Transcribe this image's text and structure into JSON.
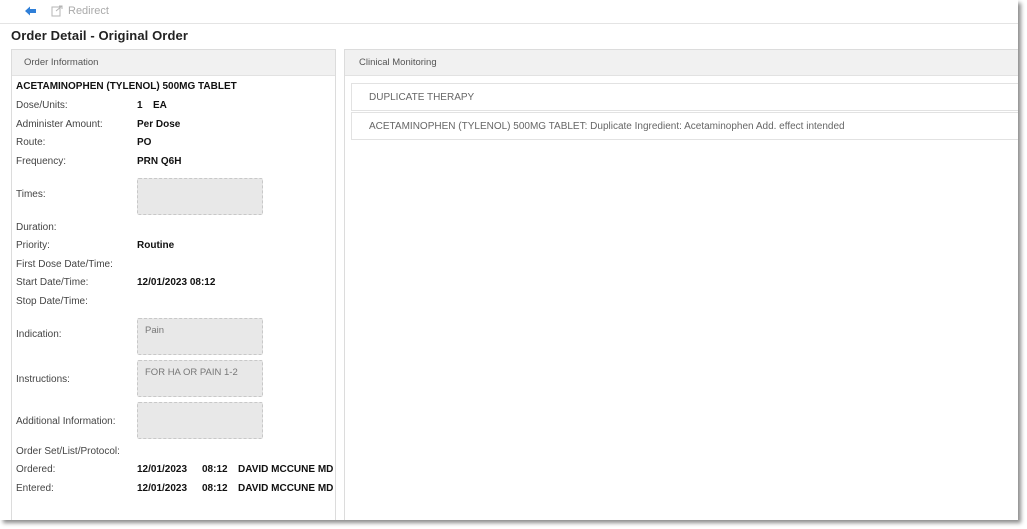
{
  "toolbar": {
    "back_icon": "back-arrow-icon",
    "redirect_label": "Redirect"
  },
  "page_title": "Order Detail - Original Order",
  "order_info": {
    "header": "Order Information",
    "drug_name": "ACETAMINOPHEN (TYLENOL) 500MG TABLET",
    "dose_units": {
      "label": "Dose/Units:",
      "value": "1",
      "unit": "EA"
    },
    "administer_amount": {
      "label": "Administer Amount:",
      "value": "Per Dose"
    },
    "route": {
      "label": "Route:",
      "value": "PO"
    },
    "frequency": {
      "label": "Frequency:",
      "value": "PRN Q6H"
    },
    "times": {
      "label": "Times:",
      "value": ""
    },
    "duration": {
      "label": "Duration:",
      "value": ""
    },
    "priority": {
      "label": "Priority:",
      "value": "Routine"
    },
    "first_dose": {
      "label": "First Dose Date/Time:",
      "value": ""
    },
    "start_date": {
      "label": "Start Date/Time:",
      "value": "12/01/2023 08:12"
    },
    "stop_date": {
      "label": "Stop Date/Time:",
      "value": ""
    },
    "indication": {
      "label": "Indication:",
      "value": "Pain"
    },
    "instructions": {
      "label": "Instructions:",
      "value": "FOR HA  OR PAIN 1-2"
    },
    "additional_info": {
      "label": "Additional Information:",
      "value": ""
    },
    "order_set": {
      "label": "Order Set/List/Protocol:",
      "value": ""
    },
    "ordered": {
      "label": "Ordered:",
      "date": "12/01/2023",
      "time": "08:12",
      "by": "DAVID MCCUNE MD"
    },
    "entered": {
      "label": "Entered:",
      "date": "12/01/2023",
      "time": "08:12",
      "by": "DAVID MCCUNE MD"
    }
  },
  "clinical_monitoring": {
    "header": "Clinical Monitoring",
    "alerts": [
      "DUPLICATE THERAPY",
      "ACETAMINOPHEN (TYLENOL) 500MG TABLET: Duplicate Ingredient: Acetaminophen Add. effect intended"
    ]
  },
  "colors": {
    "back_arrow": "#2f7fd8",
    "panel_header_bg": "#f1f1f1",
    "textbox_bg": "#e8e8e8"
  }
}
